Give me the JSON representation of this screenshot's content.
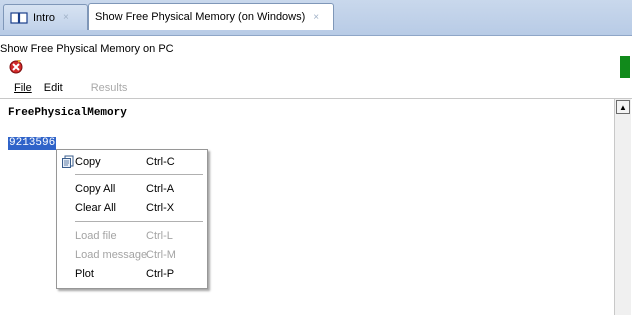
{
  "tabs": [
    {
      "label": "Intro",
      "icon": "book-icon",
      "close": "×"
    },
    {
      "label": "Show Free Physical Memory (on Windows)",
      "close": "×"
    }
  ],
  "subtitle": "Show Free Physical Memory on PC",
  "toolbar": {
    "stop_icon": "stop-icon",
    "indicator_color": "#118a1b"
  },
  "menubar": {
    "file": "File",
    "edit": "Edit",
    "results": "Results"
  },
  "output": {
    "header": "FreePhysicalMemory",
    "selected_value": "9213596"
  },
  "context_menu": {
    "copy": {
      "label": "Copy",
      "shortcut": "Ctrl-C",
      "icon": "copy-icon"
    },
    "copy_all": {
      "label": "Copy All",
      "shortcut": "Ctrl-A"
    },
    "clear_all": {
      "label": "Clear All",
      "shortcut": "Ctrl-X"
    },
    "load_file": {
      "label": "Load file",
      "shortcut": "Ctrl-L"
    },
    "load_message": {
      "label": "Load message",
      "shortcut": "Ctrl-M"
    },
    "plot": {
      "label": "Plot",
      "shortcut": "Ctrl-P"
    }
  },
  "scrollbar": {
    "up_glyph": "▲"
  }
}
